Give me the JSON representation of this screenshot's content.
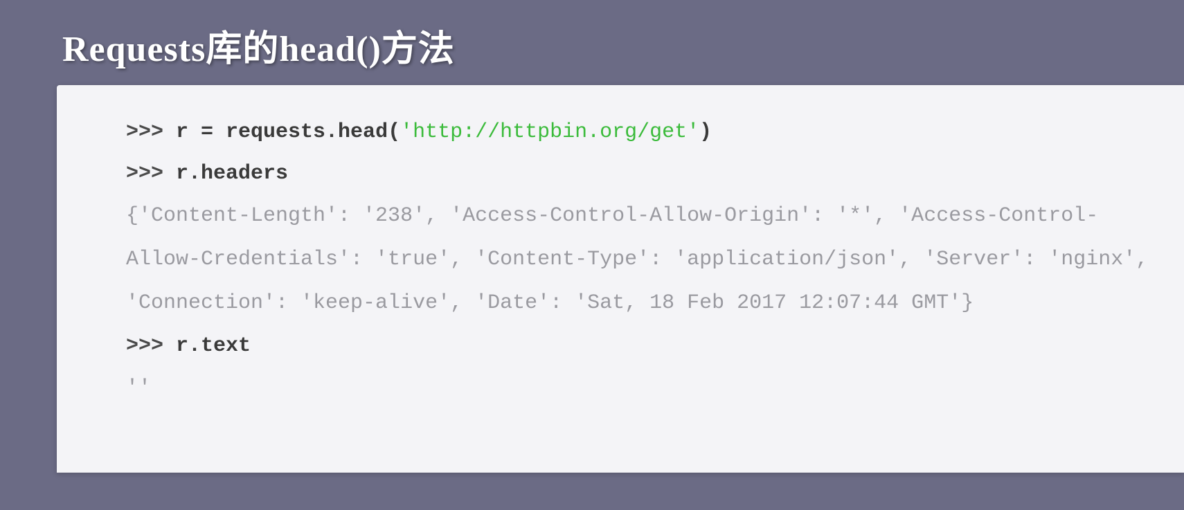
{
  "title": "Requests库的head()方法",
  "code": {
    "line1_prompt": ">>> ",
    "line1_before": "r = requests.head(",
    "line1_url": "'http://httpbin.org/get'",
    "line1_after": ")",
    "line2_prompt": ">>> ",
    "line2_code": "r.headers",
    "output1": "{'Content-Length': '238', 'Access-Control-Allow-Origin': '*', 'Access-Control-Allow-Credentials': 'true', 'Content-Type': 'application/json', 'Server': 'nginx', 'Connection': 'keep-alive', 'Date': 'Sat, 18 Feb 2017 12:07:44 GMT'}",
    "line3_prompt": ">>> ",
    "line3_code": "r.text",
    "output2": "''"
  }
}
